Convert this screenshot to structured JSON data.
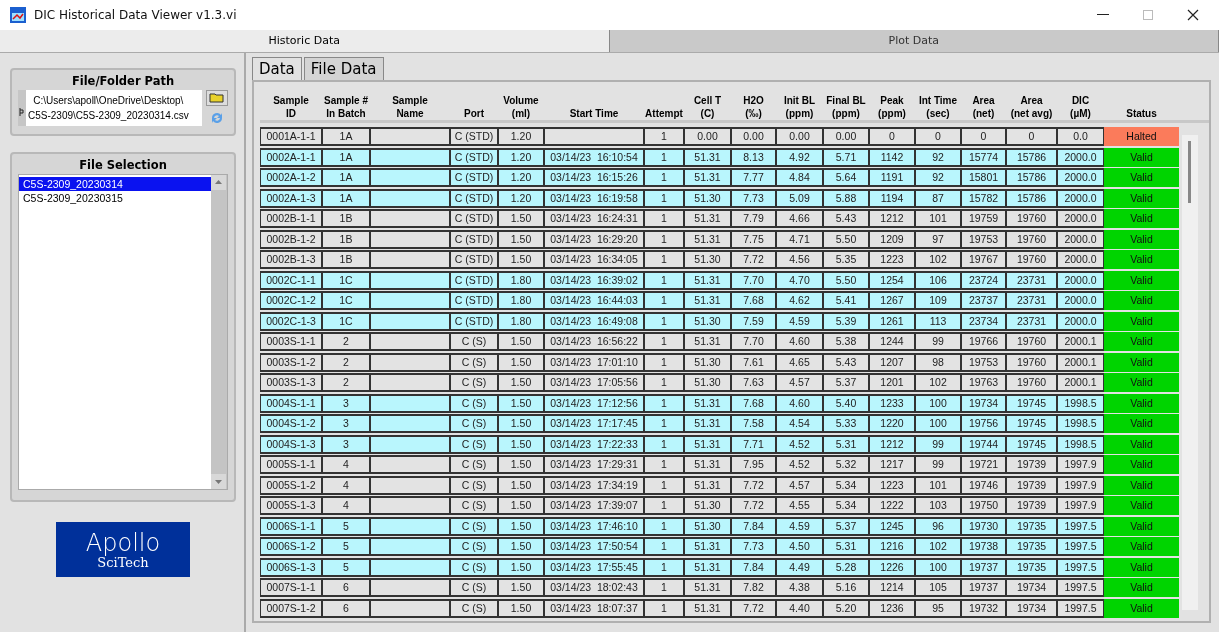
{
  "window": {
    "title": "DIC Historical Data Viewer v1.3.vi"
  },
  "main_tabs": [
    {
      "label": "Historic Data",
      "selected": true
    },
    {
      "label": "Plot Data",
      "selected": false
    }
  ],
  "file_path": {
    "label": "File/Folder Path",
    "value": "C:\\Users\\apoll\\OneDrive\\Desktop\\\nC5S-2309\\C5S-2309_20230314.csv"
  },
  "file_selection": {
    "label": "File Selection",
    "items": [
      {
        "label": "C5S-2309_20230314",
        "selected": true
      },
      {
        "label": "C5S-2309_20230315",
        "selected": false
      }
    ]
  },
  "logo": {
    "line1": "Apollo",
    "line2": "SciTech"
  },
  "data_tabs": [
    {
      "label": "Data",
      "selected": true
    },
    {
      "label": "File Data",
      "selected": false
    }
  ],
  "table": {
    "columns": [
      "Sample\nID",
      "Sample #\nIn Batch",
      "Sample\nName",
      "Port",
      "Volume\n(ml)",
      "Start Time",
      "Attempt",
      "Cell T\n(C)",
      "H2O\n(‰)",
      "Init BL\n(ppm)",
      "Final BL\n(ppm)",
      "Peak\n(ppm)",
      "Int Time\n(sec)",
      "Area\n(net)",
      "Area\n(net avg)",
      "DIC\n(µM)",
      "Status"
    ],
    "rows": [
      {
        "color": "#e3e3e3",
        "cells": [
          "0001A-1-1",
          "1A",
          null,
          "C (STD)",
          "1.20",
          null,
          "1",
          "0.00",
          "0.00",
          "0.00",
          "0.00",
          "0",
          "0",
          "0",
          "0",
          "0.0"
        ],
        "status": {
          "text": "Halted",
          "color": "#fb7b5b"
        }
      },
      {
        "color": "#b9f6fd",
        "cells": [
          "0002A-1-1",
          "1A",
          null,
          "C (STD)",
          "1.20",
          "03/14/23  16:10:54",
          "1",
          "51.31",
          "8.13",
          "4.92",
          "5.71",
          "1142",
          "92",
          "15774",
          "15786",
          "2000.0"
        ],
        "status": {
          "text": "Valid",
          "color": "#00d400"
        }
      },
      {
        "color": "#b9f6fd",
        "cells": [
          "0002A-1-2",
          "1A",
          null,
          "C (STD)",
          "1.20",
          "03/14/23  16:15:26",
          "1",
          "51.31",
          "7.77",
          "4.84",
          "5.64",
          "1191",
          "92",
          "15801",
          "15786",
          "2000.0"
        ],
        "status": {
          "text": "Valid",
          "color": "#00d400"
        }
      },
      {
        "color": "#b9f6fd",
        "cells": [
          "0002A-1-3",
          "1A",
          null,
          "C (STD)",
          "1.20",
          "03/14/23  16:19:58",
          "1",
          "51.30",
          "7.73",
          "5.09",
          "5.88",
          "1194",
          "87",
          "15782",
          "15786",
          "2000.0"
        ],
        "status": {
          "text": "Valid",
          "color": "#00d400"
        }
      },
      {
        "color": "#e3e3e3",
        "cells": [
          "0002B-1-1",
          "1B",
          null,
          "C (STD)",
          "1.50",
          "03/14/23  16:24:31",
          "1",
          "51.31",
          "7.79",
          "4.66",
          "5.43",
          "1212",
          "101",
          "19759",
          "19760",
          "2000.0"
        ],
        "status": {
          "text": "Valid",
          "color": "#00d400"
        }
      },
      {
        "color": "#e3e3e3",
        "cells": [
          "0002B-1-2",
          "1B",
          null,
          "C (STD)",
          "1.50",
          "03/14/23  16:29:20",
          "1",
          "51.31",
          "7.75",
          "4.71",
          "5.50",
          "1209",
          "97",
          "19753",
          "19760",
          "2000.0"
        ],
        "status": {
          "text": "Valid",
          "color": "#00d400"
        }
      },
      {
        "color": "#e3e3e3",
        "cells": [
          "0002B-1-3",
          "1B",
          null,
          "C (STD)",
          "1.50",
          "03/14/23  16:34:05",
          "1",
          "51.30",
          "7.72",
          "4.56",
          "5.35",
          "1223",
          "102",
          "19767",
          "19760",
          "2000.0"
        ],
        "status": {
          "text": "Valid",
          "color": "#00d400"
        }
      },
      {
        "color": "#b9f6fd",
        "cells": [
          "0002C-1-1",
          "1C",
          null,
          "C (STD)",
          "1.80",
          "03/14/23  16:39:02",
          "1",
          "51.31",
          "7.70",
          "4.70",
          "5.50",
          "1254",
          "106",
          "23724",
          "23731",
          "2000.0"
        ],
        "status": {
          "text": "Valid",
          "color": "#00d400"
        }
      },
      {
        "color": "#b9f6fd",
        "cells": [
          "0002C-1-2",
          "1C",
          null,
          "C (STD)",
          "1.80",
          "03/14/23  16:44:03",
          "1",
          "51.31",
          "7.68",
          "4.62",
          "5.41",
          "1267",
          "109",
          "23737",
          "23731",
          "2000.0"
        ],
        "status": {
          "text": "Valid",
          "color": "#00d400"
        }
      },
      {
        "color": "#b9f6fd",
        "cells": [
          "0002C-1-3",
          "1C",
          null,
          "C (STD)",
          "1.80",
          "03/14/23  16:49:08",
          "1",
          "51.30",
          "7.59",
          "4.59",
          "5.39",
          "1261",
          "113",
          "23734",
          "23731",
          "2000.0"
        ],
        "status": {
          "text": "Valid",
          "color": "#00d400"
        }
      },
      {
        "color": "#e3e3e3",
        "cells": [
          "0003S-1-1",
          "2",
          null,
          "C (S)",
          "1.50",
          "03/14/23  16:56:22",
          "1",
          "51.31",
          "7.70",
          "4.60",
          "5.38",
          "1244",
          "99",
          "19766",
          "19760",
          "2000.1"
        ],
        "status": {
          "text": "Valid",
          "color": "#00d400"
        }
      },
      {
        "color": "#e3e3e3",
        "cells": [
          "0003S-1-2",
          "2",
          null,
          "C (S)",
          "1.50",
          "03/14/23  17:01:10",
          "1",
          "51.30",
          "7.61",
          "4.65",
          "5.43",
          "1207",
          "98",
          "19753",
          "19760",
          "2000.1"
        ],
        "status": {
          "text": "Valid",
          "color": "#00d400"
        }
      },
      {
        "color": "#e3e3e3",
        "cells": [
          "0003S-1-3",
          "2",
          null,
          "C (S)",
          "1.50",
          "03/14/23  17:05:56",
          "1",
          "51.30",
          "7.63",
          "4.57",
          "5.37",
          "1201",
          "102",
          "19763",
          "19760",
          "2000.1"
        ],
        "status": {
          "text": "Valid",
          "color": "#00d400"
        }
      },
      {
        "color": "#b9f6fd",
        "cells": [
          "0004S-1-1",
          "3",
          null,
          "C (S)",
          "1.50",
          "03/14/23  17:12:56",
          "1",
          "51.31",
          "7.68",
          "4.60",
          "5.40",
          "1233",
          "100",
          "19734",
          "19745",
          "1998.5"
        ],
        "status": {
          "text": "Valid",
          "color": "#00d400"
        }
      },
      {
        "color": "#b9f6fd",
        "cells": [
          "0004S-1-2",
          "3",
          null,
          "C (S)",
          "1.50",
          "03/14/23  17:17:45",
          "1",
          "51.31",
          "7.58",
          "4.54",
          "5.33",
          "1220",
          "100",
          "19756",
          "19745",
          "1998.5"
        ],
        "status": {
          "text": "Valid",
          "color": "#00d400"
        }
      },
      {
        "color": "#b9f6fd",
        "cells": [
          "0004S-1-3",
          "3",
          null,
          "C (S)",
          "1.50",
          "03/14/23  17:22:33",
          "1",
          "51.31",
          "7.71",
          "4.52",
          "5.31",
          "1212",
          "99",
          "19744",
          "19745",
          "1998.5"
        ],
        "status": {
          "text": "Valid",
          "color": "#00d400"
        }
      },
      {
        "color": "#e3e3e3",
        "cells": [
          "0005S-1-1",
          "4",
          null,
          "C (S)",
          "1.50",
          "03/14/23  17:29:31",
          "1",
          "51.31",
          "7.95",
          "4.52",
          "5.32",
          "1217",
          "99",
          "19721",
          "19739",
          "1997.9"
        ],
        "status": {
          "text": "Valid",
          "color": "#00d400"
        }
      },
      {
        "color": "#e3e3e3",
        "cells": [
          "0005S-1-2",
          "4",
          null,
          "C (S)",
          "1.50",
          "03/14/23  17:34:19",
          "1",
          "51.31",
          "7.72",
          "4.57",
          "5.34",
          "1223",
          "101",
          "19746",
          "19739",
          "1997.9"
        ],
        "status": {
          "text": "Valid",
          "color": "#00d400"
        }
      },
      {
        "color": "#e3e3e3",
        "cells": [
          "0005S-1-3",
          "4",
          null,
          "C (S)",
          "1.50",
          "03/14/23  17:39:07",
          "1",
          "51.30",
          "7.72",
          "4.55",
          "5.34",
          "1222",
          "103",
          "19750",
          "19739",
          "1997.9"
        ],
        "status": {
          "text": "Valid",
          "color": "#00d400"
        }
      },
      {
        "color": "#b9f6fd",
        "cells": [
          "0006S-1-1",
          "5",
          null,
          "C (S)",
          "1.50",
          "03/14/23  17:46:10",
          "1",
          "51.30",
          "7.84",
          "4.59",
          "5.37",
          "1245",
          "96",
          "19730",
          "19735",
          "1997.5"
        ],
        "status": {
          "text": "Valid",
          "color": "#00d400"
        }
      },
      {
        "color": "#b9f6fd",
        "cells": [
          "0006S-1-2",
          "5",
          null,
          "C (S)",
          "1.50",
          "03/14/23  17:50:54",
          "1",
          "51.31",
          "7.73",
          "4.50",
          "5.31",
          "1216",
          "102",
          "19738",
          "19735",
          "1997.5"
        ],
        "status": {
          "text": "Valid",
          "color": "#00d400"
        }
      },
      {
        "color": "#b9f6fd",
        "cells": [
          "0006S-1-3",
          "5",
          null,
          "C (S)",
          "1.50",
          "03/14/23  17:55:45",
          "1",
          "51.31",
          "7.84",
          "4.49",
          "5.28",
          "1226",
          "100",
          "19737",
          "19735",
          "1997.5"
        ],
        "status": {
          "text": "Valid",
          "color": "#00d400"
        }
      },
      {
        "color": "#e3e3e3",
        "cells": [
          "0007S-1-1",
          "6",
          null,
          "C (S)",
          "1.50",
          "03/14/23  18:02:43",
          "1",
          "51.31",
          "7.82",
          "4.38",
          "5.16",
          "1214",
          "105",
          "19737",
          "19734",
          "1997.5"
        ],
        "status": {
          "text": "Valid",
          "color": "#00d400"
        }
      },
      {
        "color": "#e3e3e3",
        "cells": [
          "0007S-1-2",
          "6",
          null,
          "C (S)",
          "1.50",
          "03/14/23  18:07:37",
          "1",
          "51.31",
          "7.72",
          "4.40",
          "5.20",
          "1236",
          "95",
          "19732",
          "19734",
          "1997.5"
        ],
        "status": {
          "text": "Valid",
          "color": "#00d400"
        }
      }
    ]
  }
}
